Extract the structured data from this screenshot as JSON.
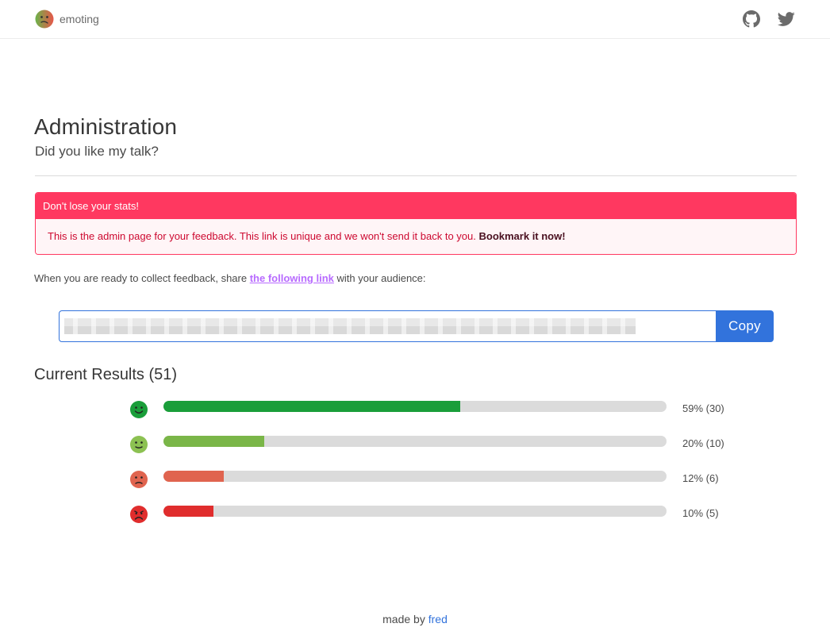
{
  "navbar": {
    "brand_name": "emoting",
    "logo_icon": "emoting-logo-icon",
    "github_icon": "github-icon",
    "twitter_icon": "twitter-icon"
  },
  "header": {
    "title": "Administration",
    "subtitle": "Did you like my talk?"
  },
  "message": {
    "header": "Don't lose your stats!",
    "body": "This is the admin page for your feedback. This link is unique and we won't send it back to you. ",
    "body_strong": "Bookmark it now!"
  },
  "share": {
    "prefix": "When you are ready to collect feedback, share ",
    "link_text": "the following link",
    "suffix": " with your audience:"
  },
  "link_input": {
    "value": ""
  },
  "copy_button": {
    "label": "Copy"
  },
  "results": {
    "title": "Current Results (51)",
    "items": [
      {
        "icon": "very-happy-face-icon",
        "label": "59% (30)",
        "fraction": 0.59,
        "color": "#1a9e3a"
      },
      {
        "icon": "happy-face-icon",
        "label": "20% (10)",
        "fraction": 0.2,
        "color": "#7ab648"
      },
      {
        "icon": "sad-face-icon",
        "label": "12% (6)",
        "fraction": 0.12,
        "color": "#e0644f"
      },
      {
        "icon": "very-sad-face-icon",
        "label": "10% (5)",
        "fraction": 0.1,
        "color": "#e02d2d"
      }
    ]
  },
  "footer": {
    "prefix": "made by ",
    "link_text": "fred"
  },
  "colors": {
    "primary": "#3273dc",
    "danger": "#ff3860",
    "link_visited": "#b86bff"
  }
}
